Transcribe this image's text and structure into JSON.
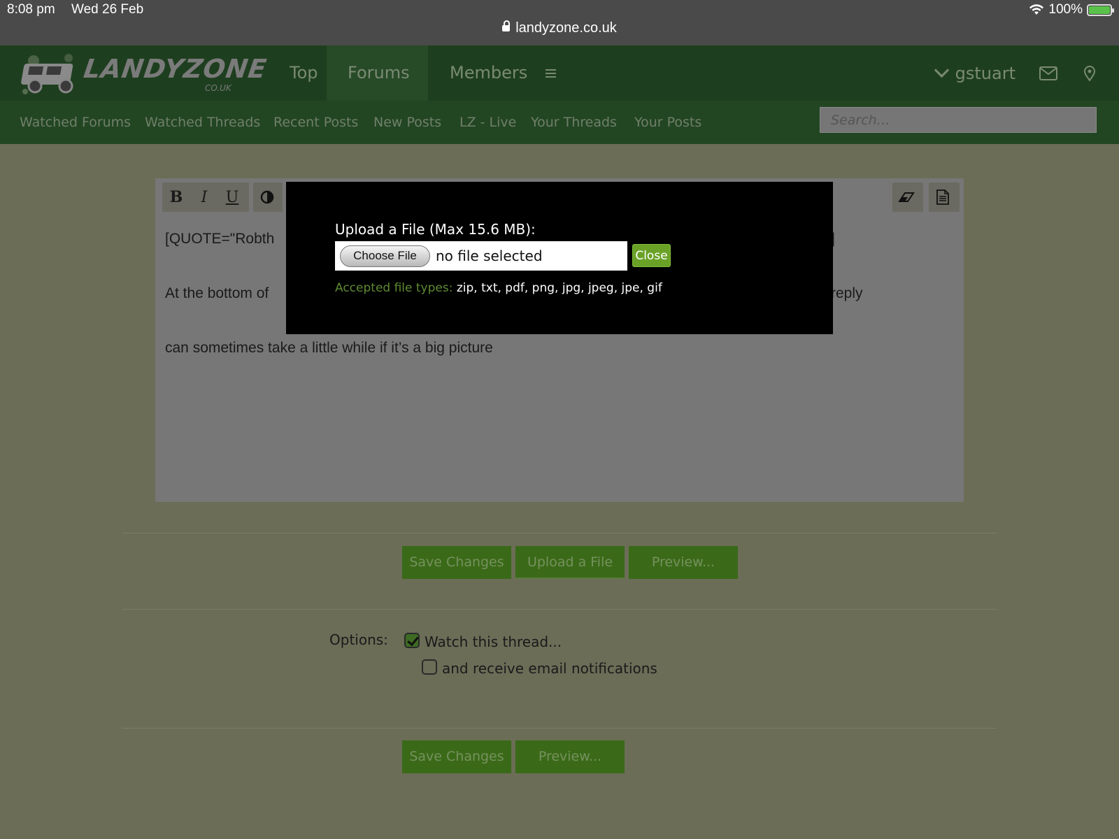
{
  "status_bar": {
    "time": "8:08 pm",
    "date": "Wed 26 Feb",
    "battery": "100%",
    "url": "landyzone.co.uk"
  },
  "header": {
    "logo_text": "LANDYZONE",
    "logo_sub": "CO.UK",
    "tabs": [
      {
        "label": "Top"
      },
      {
        "label": "Forums"
      },
      {
        "label": "Members"
      }
    ],
    "username": "gstuart"
  },
  "subnav": {
    "items": [
      "Watched Forums",
      "Watched Threads",
      "Recent Posts",
      "New Posts",
      "LZ - Live",
      "Your Threads",
      "Your Posts"
    ],
    "search_placeholder": "Search…"
  },
  "editor": {
    "toolbar": {
      "bold": "B",
      "italic": "I",
      "underline": "U"
    },
    "lines": [
      "[QUOTE=\"Robth",
      "]",
      "At the bottom of",
      "reply",
      "can sometimes take a little while if it’s a big picture"
    ]
  },
  "actions": {
    "save": "Save Changes",
    "upload": "Upload a File",
    "preview": "Preview..."
  },
  "options": {
    "label": "Options:",
    "watch_thread": "Watch this thread...",
    "email_notifications": "and receive email notifications"
  },
  "modal": {
    "title": "Upload a File (Max 15.6 MB):",
    "choose_file": "Choose File",
    "file_status": "no file selected",
    "close": "Close",
    "accepted_label": "Accepted file types:",
    "accepted_types": "zip, txt, pdf, png, jpg, jpeg, jpe, gif"
  },
  "colors": {
    "header_bg": "#1e3f1f",
    "button_bg": "#3a6a18",
    "close_btn": "#6aa227"
  }
}
